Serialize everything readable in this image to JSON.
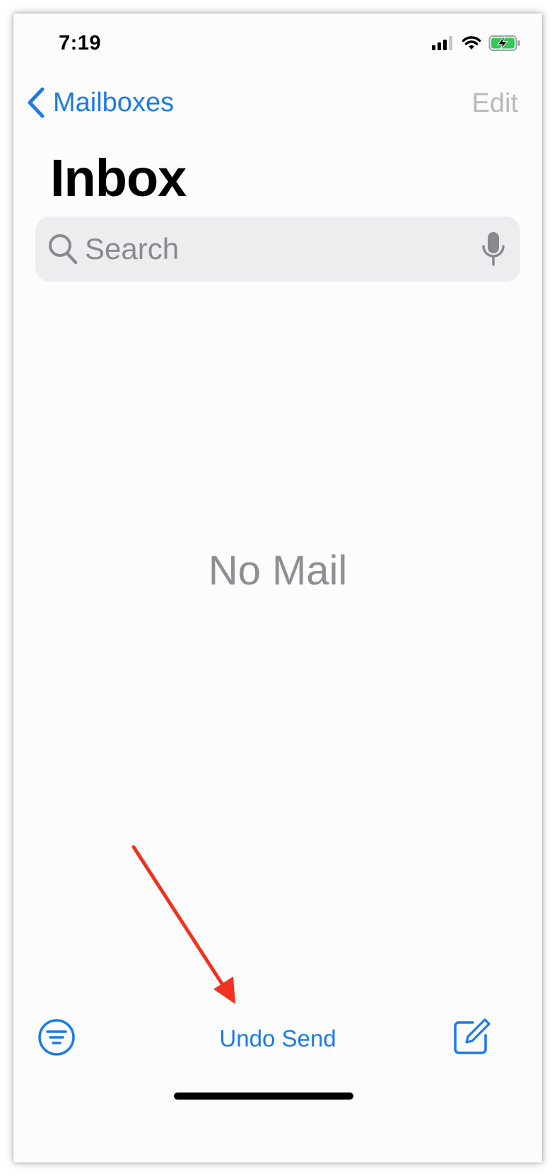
{
  "status_bar": {
    "time": "7:19",
    "icons": [
      "cellular-signal-icon",
      "wifi-icon",
      "battery-charging-icon"
    ]
  },
  "nav": {
    "back_label": "Mailboxes",
    "edit_label": "Edit"
  },
  "page": {
    "title": "Inbox"
  },
  "search": {
    "placeholder": "Search",
    "value": ""
  },
  "empty_state": {
    "message": "No Mail"
  },
  "toolbar": {
    "undo_send_label": "Undo Send",
    "filter_icon": "filter-icon",
    "compose_icon": "compose-icon"
  },
  "colors": {
    "accent": "#1a7bea",
    "disabled": "#b9b9bd",
    "annotation": "#f0321e",
    "battery_fill": "#34c759"
  }
}
